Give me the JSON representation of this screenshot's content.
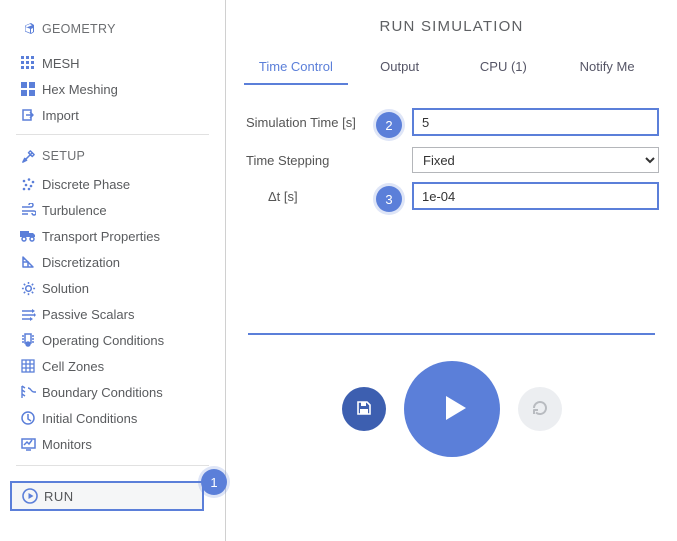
{
  "sidebar": {
    "groups": [
      {
        "label": "GEOMETRY",
        "items": [
          {
            "label": "MESH"
          },
          {
            "label": "Hex Meshing"
          },
          {
            "label": "Import"
          }
        ]
      },
      {
        "label": "SETUP",
        "items": [
          {
            "label": "Discrete Phase"
          },
          {
            "label": "Turbulence"
          },
          {
            "label": "Transport Properties"
          },
          {
            "label": "Discretization"
          },
          {
            "label": "Solution"
          },
          {
            "label": "Passive Scalars"
          },
          {
            "label": "Operating Conditions"
          },
          {
            "label": "Cell Zones"
          },
          {
            "label": "Boundary Conditions"
          },
          {
            "label": "Initial Conditions"
          },
          {
            "label": "Monitors"
          }
        ]
      }
    ],
    "run_label": "RUN"
  },
  "panel": {
    "title": "RUN SIMULATION",
    "tabs": [
      {
        "label": "Time Control",
        "active": true
      },
      {
        "label": "Output"
      },
      {
        "label": "CPU  (1)"
      },
      {
        "label": "Notify Me"
      }
    ],
    "form": {
      "sim_time_label": "Simulation Time [s]",
      "sim_time_value": "5",
      "time_stepping_label": "Time Stepping",
      "time_stepping_value": "Fixed",
      "dt_label": "Δt [s]",
      "dt_value": "1e-04"
    }
  },
  "callouts": {
    "one": "1",
    "two": "2",
    "three": "3"
  },
  "colors": {
    "accent": "#5b7fd9",
    "accent_dark": "#3d5fb0"
  }
}
